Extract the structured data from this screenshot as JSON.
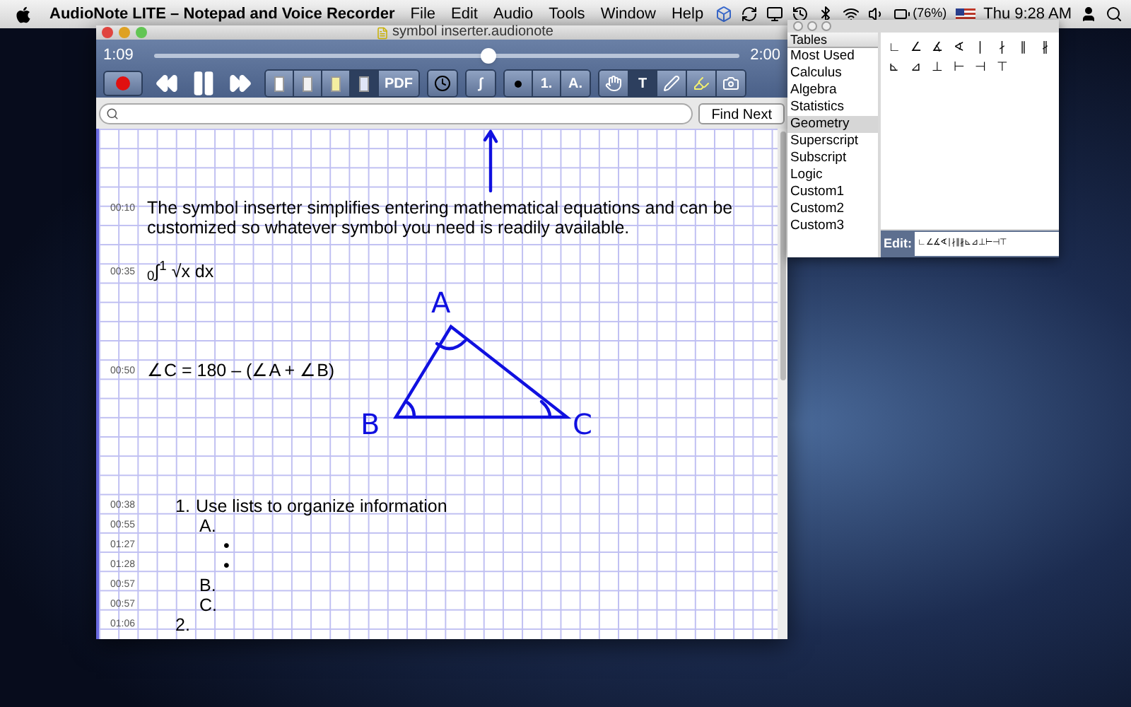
{
  "menu_bar": {
    "app_name": "AudioNote LITE – Notepad and Voice Recorder",
    "menus": [
      "File",
      "Edit",
      "Audio",
      "Tools",
      "Window",
      "Help"
    ],
    "battery": "(76%)",
    "clock": "Thu 9:28 AM"
  },
  "window": {
    "title": "symbol inserter.audionote",
    "player": {
      "elapsed": "1:09",
      "total": "2:00",
      "level": 0.57
    },
    "tools": [
      [
        {
          "kind": "record",
          "selected": false
        }
      ],
      [
        {
          "kind": "rewind",
          "selected": false
        },
        {
          "kind": "pause",
          "selected": false
        },
        {
          "kind": "forward",
          "selected": false
        }
      ],
      [
        {
          "kind": "page",
          "color": "#ffffff",
          "selected": false
        },
        {
          "kind": "page",
          "color": "#f2f2f2",
          "selected": false
        },
        {
          "kind": "page",
          "color": "#f4eea0",
          "selected": false
        },
        {
          "kind": "page",
          "color": "#dfe6f7",
          "selected": true
        },
        {
          "kind": "text",
          "label": "PDF",
          "selected": false
        }
      ],
      [
        {
          "kind": "clock",
          "selected": false
        }
      ],
      [
        {
          "kind": "text",
          "label": "∫",
          "selected": false
        }
      ],
      [
        {
          "kind": "bullet",
          "selected": false
        },
        {
          "kind": "text",
          "label": "1.",
          "selected": false
        },
        {
          "kind": "text",
          "label": "A.",
          "selected": false
        }
      ],
      [
        {
          "kind": "hand",
          "selected": false
        },
        {
          "kind": "text",
          "label": "T",
          "selected": true
        },
        {
          "kind": "pen",
          "selected": false
        },
        {
          "kind": "highlighter",
          "selected": false
        },
        {
          "kind": "camera",
          "selected": false
        }
      ]
    ],
    "find_button": "Find Next",
    "notes": [
      {
        "kind": "text",
        "time": "00:10",
        "text": "The symbol inserter simplifies entering mathematical equations and can be customized so whatever symbol you need is readily available."
      },
      {
        "kind": "text",
        "time": "00:35",
        "text": "$_{0}$∫$^{1}$ √x dx"
      },
      {
        "kind": "text",
        "time": "00:50",
        "text": "∠C = 180 – (∠A + ∠B)"
      },
      {
        "kind": "list",
        "items": [
          {
            "time": "00:38",
            "marker": "1.",
            "text": "Use lists to organize information",
            "children": [
              {
                "time": "00:55",
                "marker": "A.",
                "children": [
                  {
                    "time": "01:27",
                    "marker": "•"
                  },
                  {
                    "time": "01:28",
                    "marker": "•"
                  }
                ]
              },
              {
                "time": "00:57",
                "marker": "B."
              },
              {
                "time": "00:57",
                "marker": "C."
              }
            ]
          },
          {
            "time": "01:06",
            "marker": "2."
          }
        ]
      }
    ],
    "sketch": {
      "vertex_labels": [
        "A",
        "B",
        "C"
      ]
    }
  },
  "symbol_panel": {
    "header": "Tables",
    "tables": [
      {
        "label": "Most Used",
        "selected": false
      },
      {
        "label": "Calculus",
        "selected": false
      },
      {
        "label": "Algebra",
        "selected": false
      },
      {
        "label": "Statistics",
        "selected": false
      },
      {
        "label": "Geometry",
        "selected": true
      },
      {
        "label": "Superscript",
        "selected": false
      },
      {
        "label": "Subscript",
        "selected": false
      },
      {
        "label": "Logic",
        "selected": false
      },
      {
        "label": "Custom1",
        "selected": false
      },
      {
        "label": "Custom2",
        "selected": false
      },
      {
        "label": "Custom3",
        "selected": false
      }
    ],
    "symbols": [
      "∟",
      "∠",
      "∡",
      "∢",
      "∣",
      "∤",
      "∥",
      "∦",
      "⊾",
      "⊿",
      "⊥",
      "⊢",
      "⊣",
      "⊤"
    ],
    "edit_label": "Edit:",
    "edit_value": "∟∠∡∢∣∤∥∦⊾⊿⊥⊢⊣⊤"
  }
}
